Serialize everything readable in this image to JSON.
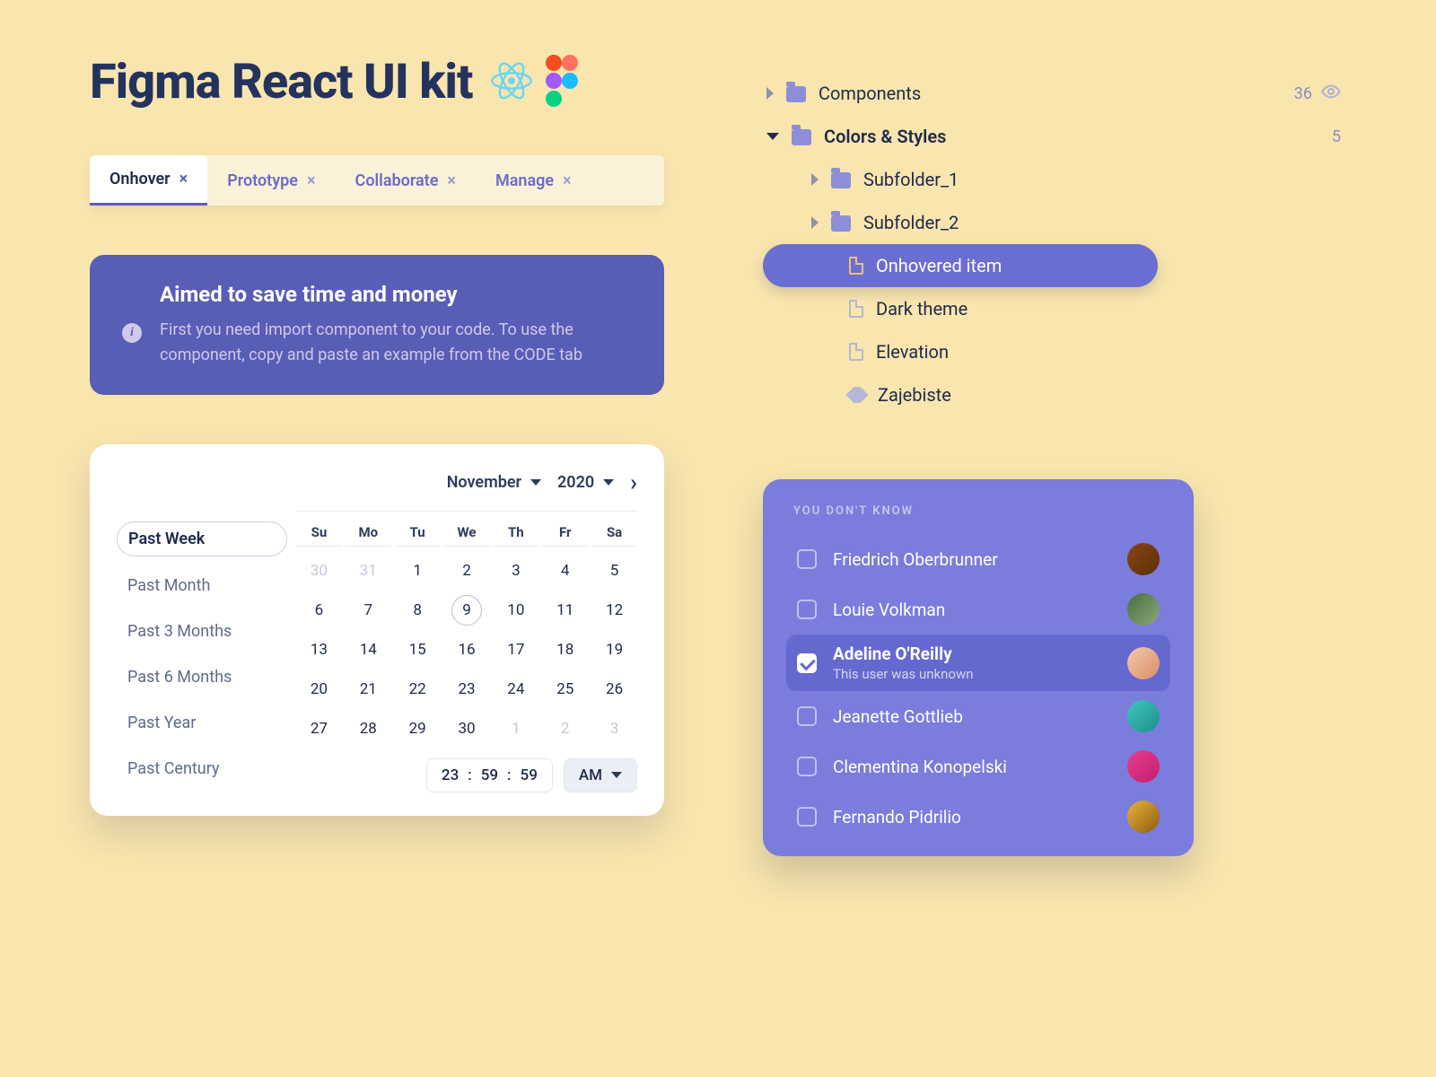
{
  "title": "Figma React UI kit",
  "tabs": [
    {
      "label": "Onhover",
      "active": true
    },
    {
      "label": "Prototype",
      "active": false
    },
    {
      "label": "Collaborate",
      "active": false
    },
    {
      "label": "Manage",
      "active": false
    }
  ],
  "callout": {
    "title": "Aimed to save time and money",
    "body": "First you need import component to your code. To use the component, copy and paste an example from the CODE tab"
  },
  "calendar": {
    "presets": [
      "Past Week",
      "Past Month",
      "Past 3 Months",
      "Past 6 Months",
      "Past Year",
      "Past Century"
    ],
    "active_preset": "Past Week",
    "month": "November",
    "year": "2020",
    "dow": [
      "Su",
      "Mo",
      "Tu",
      "We",
      "Th",
      "Fr",
      "Sa"
    ],
    "lead_dim": [
      "30",
      "31"
    ],
    "days": [
      "1",
      "2",
      "3",
      "4",
      "5",
      "6",
      "7",
      "8",
      "9",
      "10",
      "11",
      "12",
      "13",
      "14",
      "15",
      "16",
      "17",
      "18",
      "19",
      "20",
      "21",
      "22",
      "23",
      "24",
      "25",
      "26",
      "27",
      "28",
      "29",
      "30"
    ],
    "trail_dim": [
      "1",
      "2",
      "3"
    ],
    "selected_day": "9",
    "time": {
      "h": "23",
      "m": "59",
      "s": "59",
      "ampm": "AM"
    }
  },
  "tree": {
    "root1": {
      "label": "Components",
      "count": "36"
    },
    "root2": {
      "label": "Colors & Styles",
      "count": "5"
    },
    "sub1": "Subfolder_1",
    "sub2": "Subfolder_2",
    "leaf_hovered": "Onhovered item",
    "leaf2": "Dark theme",
    "leaf3": "Elevation",
    "leaf4": "Zajebiste"
  },
  "users": {
    "heading": "YOU DON'T KNOW",
    "list": [
      {
        "name": "Friedrich Oberbrunner",
        "sub": "",
        "selected": false,
        "av": "av1"
      },
      {
        "name": "Louie Volkman",
        "sub": "",
        "selected": false,
        "av": "av2"
      },
      {
        "name": "Adeline O'Reilly",
        "sub": "This user was unknown",
        "selected": true,
        "av": "av3"
      },
      {
        "name": "Jeanette Gottlieb",
        "sub": "",
        "selected": false,
        "av": "av4"
      },
      {
        "name": "Clementina Konopelski",
        "sub": "",
        "selected": false,
        "av": "av5"
      },
      {
        "name": "Fernando Pidrilio",
        "sub": "",
        "selected": false,
        "av": "av6"
      }
    ]
  }
}
